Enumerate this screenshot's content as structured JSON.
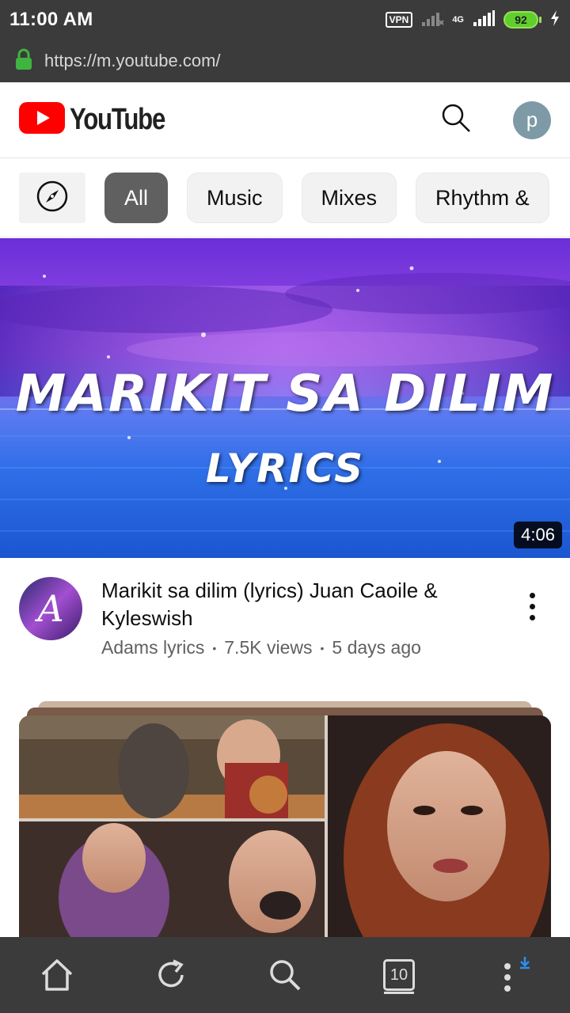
{
  "status_bar": {
    "time": "11:00 AM",
    "vpn": "VPN",
    "network": "4G",
    "battery": "92"
  },
  "browser": {
    "url": "https://m.youtube.com/"
  },
  "header": {
    "logo_text": "YouTube",
    "avatar_letter": "p"
  },
  "chips": {
    "items": [
      {
        "label": "All",
        "active": true
      },
      {
        "label": "Music",
        "active": false
      },
      {
        "label": "Mixes",
        "active": false
      },
      {
        "label": "Rhythm &",
        "active": false
      }
    ]
  },
  "video": {
    "thumbnail_title": "MARIKIT SA DILIM",
    "thumbnail_subtitle": "LYRICS",
    "duration": "4:06",
    "title": "Marikit sa dilim (lyrics) Juan Caoile & Kyleswish",
    "channel": "Adams lyrics",
    "views": "7.5K views",
    "age": "5 days ago",
    "channel_avatar_letter": "A"
  },
  "bottom_nav": {
    "tabs_count": "10"
  },
  "colors": {
    "brand_red": "#ff0000",
    "chrome_dark": "#3b3b3b",
    "active_chip": "#606060",
    "lock_green": "#3fb43f",
    "download_blue": "#2f8ef0"
  }
}
